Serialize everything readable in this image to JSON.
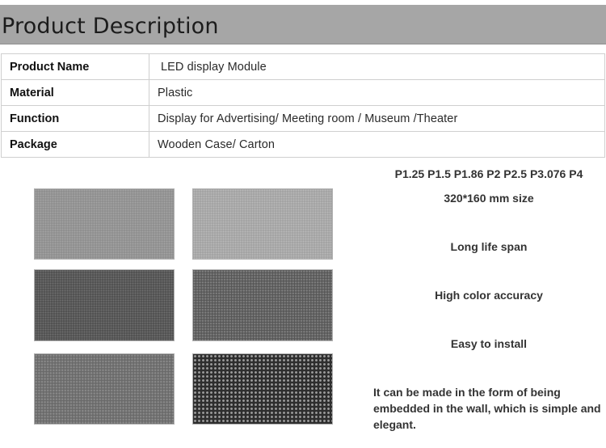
{
  "section_title": "Product Description",
  "spec_rows": [
    {
      "label": "Product Name",
      "value": "LED display Module"
    },
    {
      "label": "Material",
      "value": "Plastic"
    },
    {
      "label": "Function",
      "value": "Display for Advertising/ Meeting room / Museum /Theater"
    },
    {
      "label": "Package",
      "value": "Wooden Case/ Carton"
    }
  ],
  "features": {
    "pitches": "P1.25 P1.5 P1.86 P2 P2.5 P3.076 P4",
    "size": "320*160 mm size",
    "life": "Long life span",
    "color": "High color accuracy",
    "install": "Easy to install",
    "note": "It can be made in the form of being embedded in the wall, which is simple and elegant."
  }
}
